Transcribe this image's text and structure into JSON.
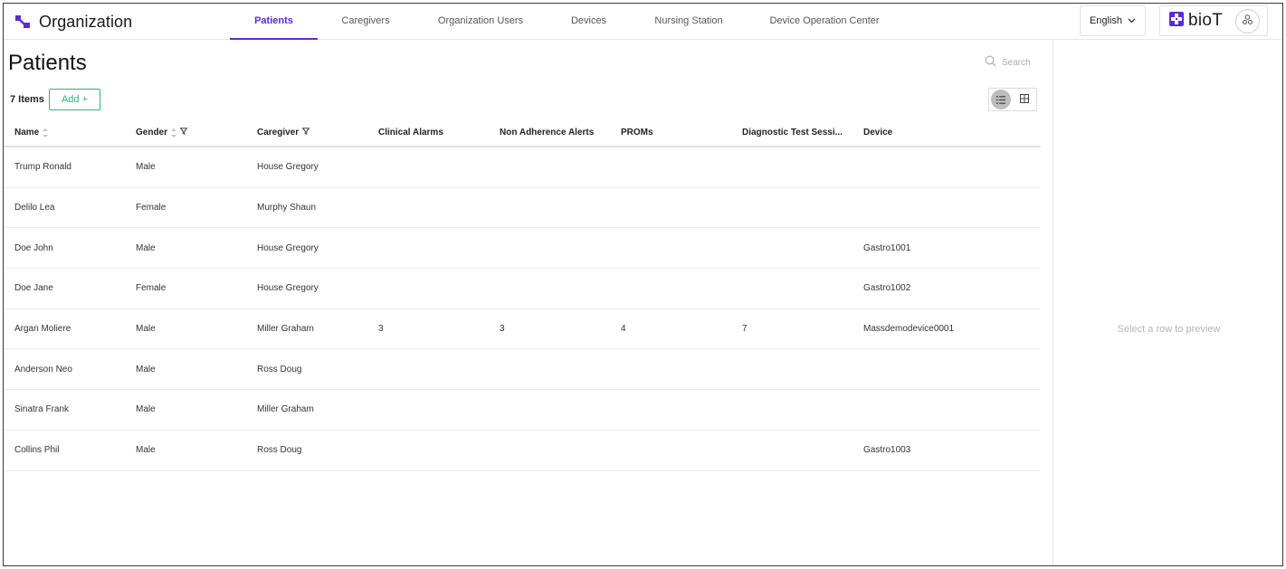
{
  "header": {
    "brand_title": "Organization",
    "tabs": [
      {
        "label": "Patients",
        "active": true
      },
      {
        "label": "Caregivers",
        "active": false
      },
      {
        "label": "Organization Users",
        "active": false
      },
      {
        "label": "Devices",
        "active": false
      },
      {
        "label": "Nursing Station",
        "active": false
      },
      {
        "label": "Device Operation Center",
        "active": false
      }
    ],
    "language": "English",
    "logo_text": "bioT",
    "colors": {
      "accent": "#5b2bd1",
      "add_button": "#2bb673"
    }
  },
  "main": {
    "title": "Patients",
    "count_label": "7 Items",
    "add_label": "Add +",
    "search_placeholder": "Search",
    "view_mode": "list",
    "columns": [
      "Name",
      "Gender",
      "Caregiver",
      "Clinical Alarms",
      "Non Adherence Alerts",
      "PROMs",
      "Diagnostic Test Sessi...",
      "Device"
    ],
    "rows": [
      [
        "Trump Ronald",
        "Male",
        "House Gregory",
        "",
        "",
        "",
        "",
        ""
      ],
      [
        "Delilo Lea",
        "Female",
        "Murphy Shaun",
        "",
        "",
        "",
        "",
        ""
      ],
      [
        "Doe John",
        "Male",
        "House Gregory",
        "",
        "",
        "",
        "",
        "Gastro1001"
      ],
      [
        "Doe Jane",
        "Female",
        "House Gregory",
        "",
        "",
        "",
        "",
        "Gastro1002"
      ],
      [
        "Argan Moliere",
        "Male",
        "Miller Graham",
        "3",
        "3",
        "4",
        "7",
        "Massdemodevice0001"
      ],
      [
        "Anderson Neo",
        "Male",
        "Ross Doug",
        "",
        "",
        "",
        "",
        ""
      ],
      [
        "Sinatra Frank",
        "Male",
        "Miller Graham",
        "",
        "",
        "",
        "",
        ""
      ],
      [
        "Collins Phil",
        "Male",
        "Ross Doug",
        "",
        "",
        "",
        "",
        "Gastro1003"
      ]
    ]
  },
  "preview": {
    "empty_text": "Select a row to preview"
  }
}
